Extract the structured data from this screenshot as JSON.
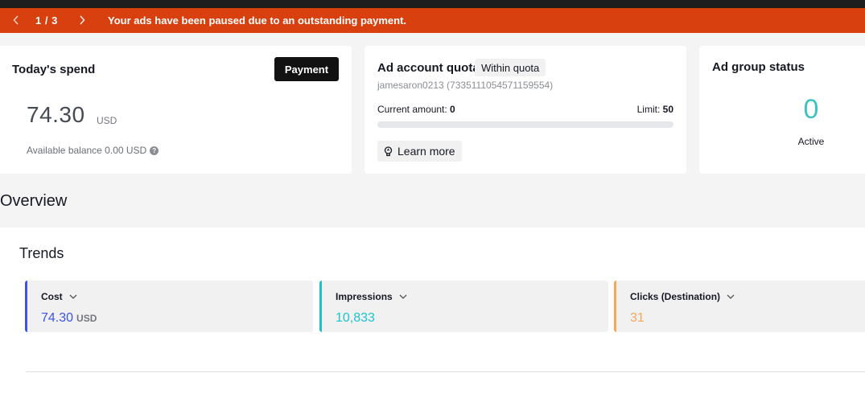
{
  "banner": {
    "pager": "1 / 3",
    "message": "Your ads have been paused due to an outstanding payment."
  },
  "spend": {
    "title": "Today's spend",
    "payment_label": "Payment",
    "value": "74.30",
    "currency": "USD",
    "balance_text": "Available balance 0.00 USD"
  },
  "quota": {
    "title": "Ad account quota",
    "badge": "Within quota",
    "account": "jamesaron0213 (7335111054571159554)",
    "current_label": "Current amount: ",
    "current_value": "0",
    "limit_label": "Limit: ",
    "limit_value": "50",
    "progress_fraction": 0,
    "learn_more_label": "Learn more"
  },
  "ad_group_status": {
    "title": "Ad group status",
    "count": "0",
    "label": "Active"
  },
  "overview": {
    "title": "Overview"
  },
  "trends": {
    "title": "Trends",
    "metrics": [
      {
        "label": "Cost",
        "value": "74.30",
        "unit": "USD",
        "color": "#3b55e6"
      },
      {
        "label": "Impressions",
        "value": "10,833",
        "unit": "",
        "color": "#1fc2cc"
      },
      {
        "label": "Clicks (Destination)",
        "value": "31",
        "unit": "",
        "color": "#f5a85a"
      }
    ]
  },
  "colors": {
    "banner": "#d8400f",
    "status_accent": "#3ec3c1"
  },
  "icons": {
    "prev": "chevron-left-icon",
    "next": "chevron-right-icon",
    "help": "help-icon",
    "learn": "lightbulb-icon",
    "dropdown": "chevron-down-icon"
  }
}
